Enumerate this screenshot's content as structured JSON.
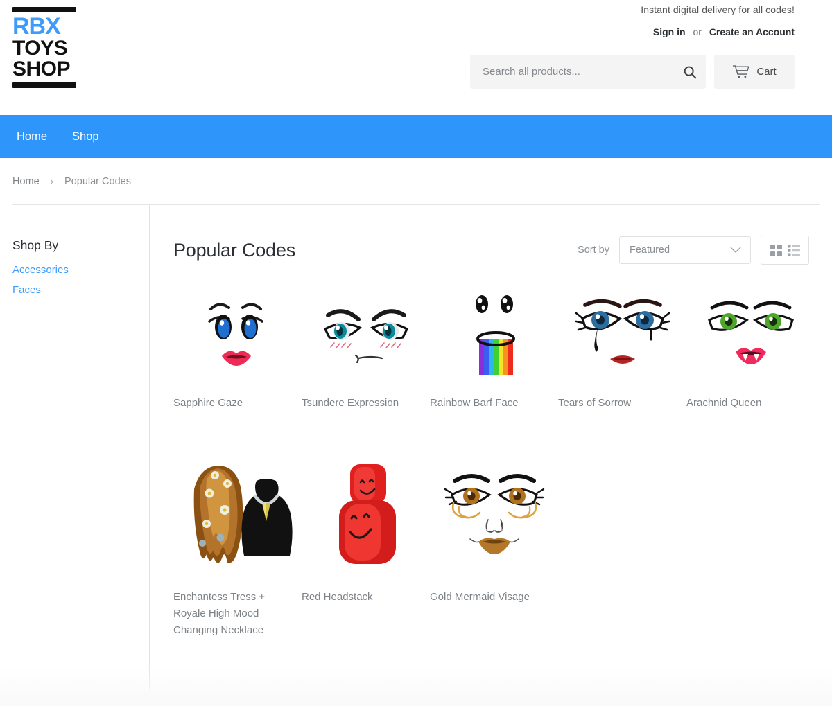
{
  "header": {
    "logo": {
      "line1": "RBX",
      "line2": "TOYS",
      "line3": "SHOP"
    },
    "promo": "Instant digital delivery for all codes!",
    "sign_in": "Sign in",
    "or": "or",
    "create_account": "Create an Account",
    "search_placeholder": "Search all products...",
    "search_value": "",
    "search_icon": "search-icon",
    "cart_label": "Cart",
    "cart_icon": "shopping-cart-icon"
  },
  "nav": {
    "items": [
      {
        "label": "Home"
      },
      {
        "label": "Shop"
      }
    ]
  },
  "breadcrumb": {
    "home": "Home",
    "separator": "›",
    "current": "Popular Codes"
  },
  "sidebar": {
    "title": "Shop By",
    "items": [
      {
        "label": "Accessories"
      },
      {
        "label": "Faces"
      }
    ]
  },
  "main": {
    "title": "Popular Codes",
    "sort_label": "Sort by",
    "sort_value": "Featured",
    "sort_icon": "chevron-down-icon",
    "view_grid_icon": "grid-view-icon",
    "view_list_icon": "list-view-icon"
  },
  "products": [
    {
      "title": "Sapphire Gaze",
      "art": "sapphire-gaze"
    },
    {
      "title": "Tsundere Expression",
      "art": "tsundere-expression"
    },
    {
      "title": "Rainbow Barf Face",
      "art": "rainbow-barf-face"
    },
    {
      "title": "Tears of Sorrow",
      "art": "tears-of-sorrow"
    },
    {
      "title": "Arachnid Queen",
      "art": "arachnid-queen"
    },
    {
      "title": "Enchantess Tress + Royale High Mood Changing Necklace",
      "art": "enchantess-tress-necklace"
    },
    {
      "title": "Red Headstack",
      "art": "red-headstack"
    },
    {
      "title": "Gold Mermaid Visage",
      "art": "gold-mermaid-visage"
    }
  ],
  "colors": {
    "nav_blue": "#2e95fa",
    "link_blue": "#3d9bfc",
    "text_gray": "#7d8287",
    "chip_gray": "#f4f4f4"
  }
}
